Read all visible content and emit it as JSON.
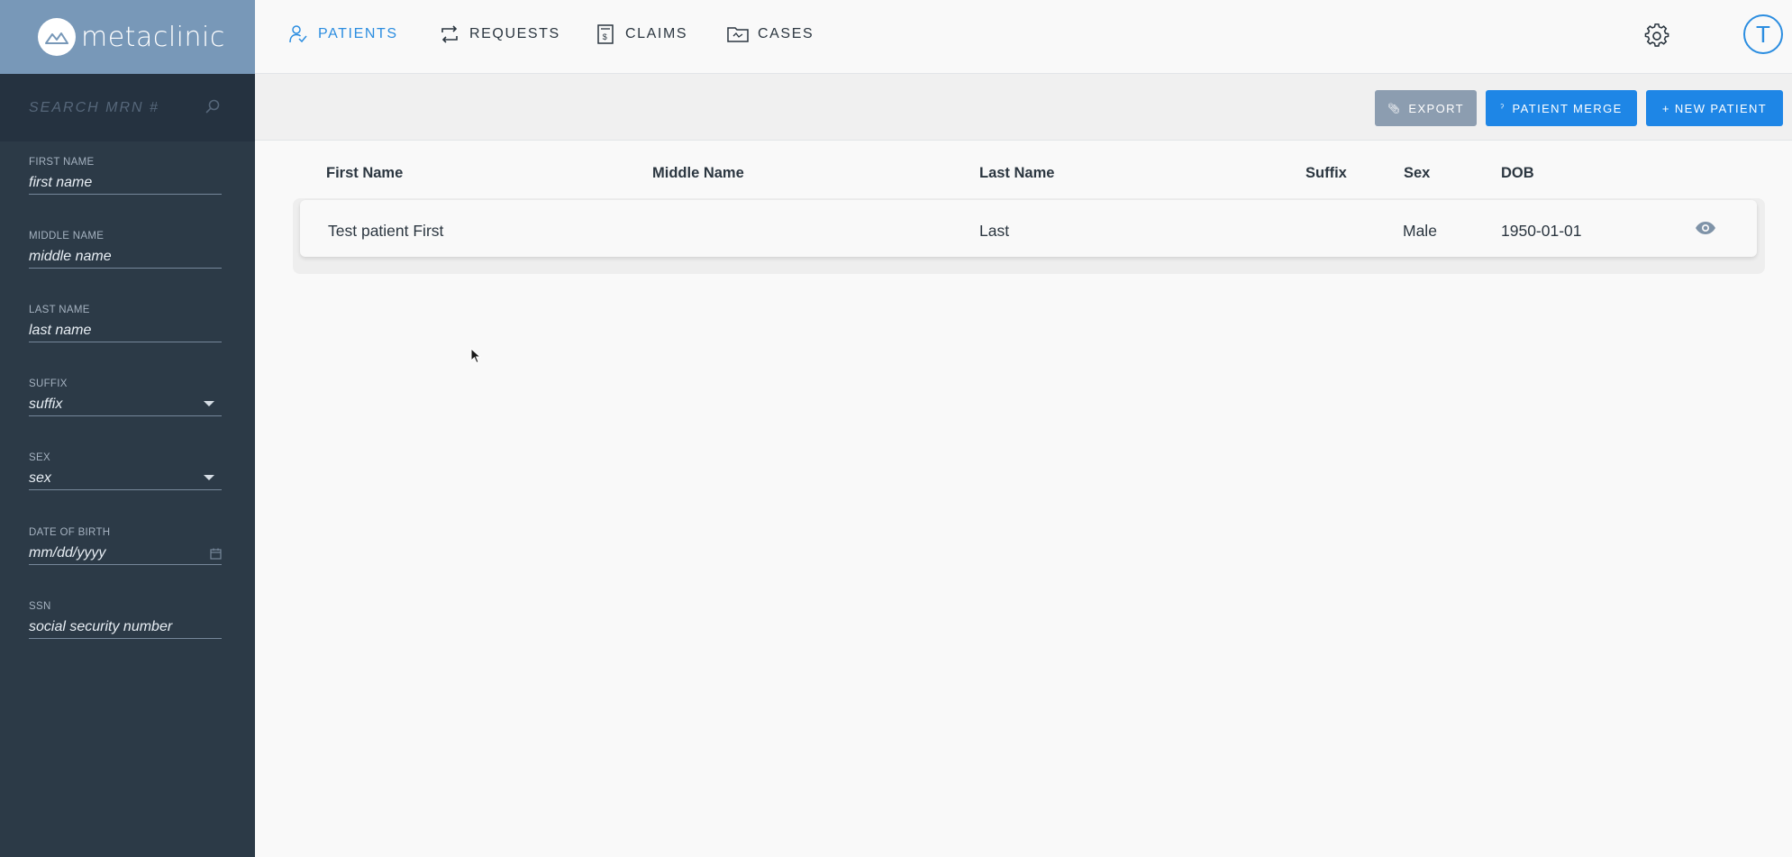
{
  "app": {
    "logo_text": "metaclinic",
    "accent_color": "#1e86e6",
    "sidebar_color": "#2c3a47",
    "logo_bg_color": "#7898b8"
  },
  "nav": {
    "items": [
      {
        "label": "PATIENTS",
        "icon": "patient-icon",
        "active": true
      },
      {
        "label": "REQUESTS",
        "icon": "repeat-arrows-icon",
        "active": false
      },
      {
        "label": "CLAIMS",
        "icon": "claim-document-icon",
        "active": false
      },
      {
        "label": "CASES",
        "icon": "folder-icon",
        "active": false
      }
    ],
    "settings_icon": "gear-icon",
    "avatar_initial": "T"
  },
  "sidebar": {
    "search": {
      "placeholder": "SEARCH MRN #",
      "value": ""
    },
    "filters": [
      {
        "label": "FIRST NAME",
        "placeholder": "first name",
        "type": "text"
      },
      {
        "label": "MIDDLE NAME",
        "placeholder": "middle name",
        "type": "text"
      },
      {
        "label": "LAST NAME",
        "placeholder": "last name",
        "type": "text"
      },
      {
        "label": "SUFFIX",
        "placeholder": "suffix",
        "type": "select"
      },
      {
        "label": "SEX",
        "placeholder": "sex",
        "type": "select"
      },
      {
        "label": "DATE OF BIRTH",
        "placeholder": "mm/dd/yyyy",
        "type": "date"
      },
      {
        "label": "SSN",
        "placeholder": "social security number",
        "type": "text"
      }
    ]
  },
  "toolbar": {
    "export_label": "EXPORT",
    "merge_label": "PATIENT MERGE",
    "new_label": "+ NEW PATIENT"
  },
  "table": {
    "columns": [
      "First Name",
      "Middle Name",
      "Last Name",
      "Suffix",
      "Sex",
      "DOB"
    ],
    "rows": [
      {
        "first_name": "Test patient First",
        "middle_name": "",
        "last_name": "Last",
        "suffix": "",
        "sex": "Male",
        "dob": "1950-01-01",
        "action_icon": "eye-icon"
      }
    ]
  }
}
